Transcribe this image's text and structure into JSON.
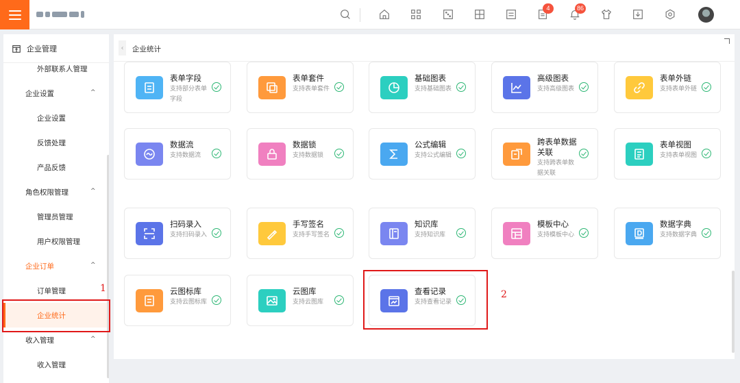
{
  "topbar": {
    "icons": [
      "search-icon",
      "home-icon",
      "apps-icon",
      "dice-icon",
      "layout-icon",
      "list-icon",
      "doc-icon",
      "bell-icon",
      "shirt-icon",
      "download-icon",
      "settings-icon"
    ],
    "doc_badge": "4",
    "bell_badge": "86",
    "accent": "#ff6a1a"
  },
  "sidebar": {
    "header": "企业管理",
    "items": [
      {
        "label": "外部联系人管理",
        "kind": "child"
      },
      {
        "label": "企业设置",
        "kind": "group"
      },
      {
        "label": "企业设置",
        "kind": "child"
      },
      {
        "label": "反馈处理",
        "kind": "child"
      },
      {
        "label": "产品反馈",
        "kind": "child"
      },
      {
        "label": "角色权限管理",
        "kind": "group"
      },
      {
        "label": "管理员管理",
        "kind": "child"
      },
      {
        "label": "用户权限管理",
        "kind": "child"
      },
      {
        "label": "企业订单",
        "kind": "group-active"
      },
      {
        "label": "订单管理",
        "kind": "child"
      },
      {
        "label": "企业统计",
        "kind": "active"
      },
      {
        "label": "收入管理",
        "kind": "group"
      },
      {
        "label": "收入管理",
        "kind": "child"
      }
    ]
  },
  "tab": {
    "label": "企业统计"
  },
  "cards": [
    {
      "title": "表单字段",
      "desc": "支持部分表单字段",
      "color": "#4fb4f5",
      "icon": "form-field-icon"
    },
    {
      "title": "表单套件",
      "desc": "支持表单套件",
      "color": "#ff9a3c",
      "icon": "form-suite-icon"
    },
    {
      "title": "基础图表",
      "desc": "支持基础图表",
      "color": "#2ccfc0",
      "icon": "pie-chart-icon"
    },
    {
      "title": "高级图表",
      "desc": "支持高级图表",
      "color": "#5b74e8",
      "icon": "line-chart-icon"
    },
    {
      "title": "表单外链",
      "desc": "支持表单外链",
      "color": "#ffc93c",
      "icon": "link-icon"
    },
    {
      "title": "数据流",
      "desc": "支持数据流",
      "color": "#7a86f0",
      "icon": "flow-icon"
    },
    {
      "title": "数据锁",
      "desc": "支持数据锁",
      "color": "#f080c0",
      "icon": "lock-icon"
    },
    {
      "title": "公式编辑",
      "desc": "支持公式编辑",
      "color": "#4aa8f0",
      "icon": "sigma-icon"
    },
    {
      "title": "跨表单数据关联",
      "desc": "支持跨表单数据关联",
      "color": "#ff9a3c",
      "icon": "relation-icon"
    },
    {
      "title": "表单视图",
      "desc": "支持表单视图",
      "color": "#2ccfc0",
      "icon": "view-icon"
    },
    {
      "title": "扫码录入",
      "desc": "支持扫码录入",
      "color": "#5b74e8",
      "icon": "scan-icon"
    },
    {
      "title": "手写签名",
      "desc": "支持手写签名",
      "color": "#ffc93c",
      "icon": "signature-icon"
    },
    {
      "title": "知识库",
      "desc": "支持知识库",
      "color": "#7a86f0",
      "icon": "book-icon"
    },
    {
      "title": "模板中心",
      "desc": "支持模板中心",
      "color": "#f080c0",
      "icon": "template-icon"
    },
    {
      "title": "数据字典",
      "desc": "支持数据字典",
      "color": "#4aa8f0",
      "icon": "dictionary-icon"
    },
    {
      "title": "云图标库",
      "desc": "支持云图标库",
      "color": "#ff9a3c",
      "icon": "cloud-icon-library-icon"
    },
    {
      "title": "云图库",
      "desc": "支持云图库",
      "color": "#2ccfc0",
      "icon": "image-icon"
    },
    {
      "title": "查看记录",
      "desc": "支持查看记录",
      "color": "#5b74e8",
      "icon": "record-icon"
    }
  ],
  "annotations": {
    "first": "1",
    "second": "2"
  }
}
